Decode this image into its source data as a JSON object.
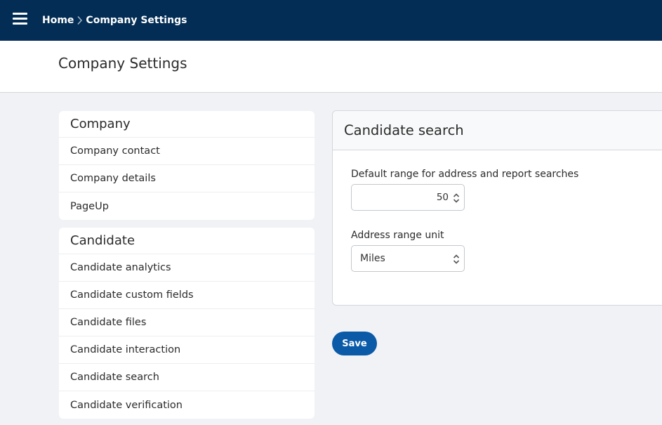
{
  "header": {
    "menu_icon": "hamburger-menu-icon",
    "breadcrumb": {
      "home": "Home",
      "separator_icon": "chevron-right-icon",
      "current": "Company Settings"
    }
  },
  "page": {
    "title": "Company Settings"
  },
  "sidebar": {
    "sections": [
      {
        "heading": "Company",
        "items": [
          "Company contact",
          "Company details",
          "PageUp"
        ]
      },
      {
        "heading": "Candidate",
        "items": [
          "Candidate analytics",
          "Candidate custom fields",
          "Candidate files",
          "Candidate interaction",
          "Candidate search",
          "Candidate verification"
        ]
      }
    ]
  },
  "panel": {
    "title": "Candidate search",
    "default_range": {
      "label": "Default range for address and report searches",
      "value": "50",
      "control_icon": "spinner-updown-icon"
    },
    "range_unit": {
      "label": "Address range unit",
      "selected": "Miles",
      "control_icon": "select-updown-icon"
    }
  },
  "actions": {
    "save_label": "Save"
  },
  "colors": {
    "topbar": "#032d54",
    "primary_button": "#0a5aa8",
    "page_background": "#f0f2f5"
  }
}
